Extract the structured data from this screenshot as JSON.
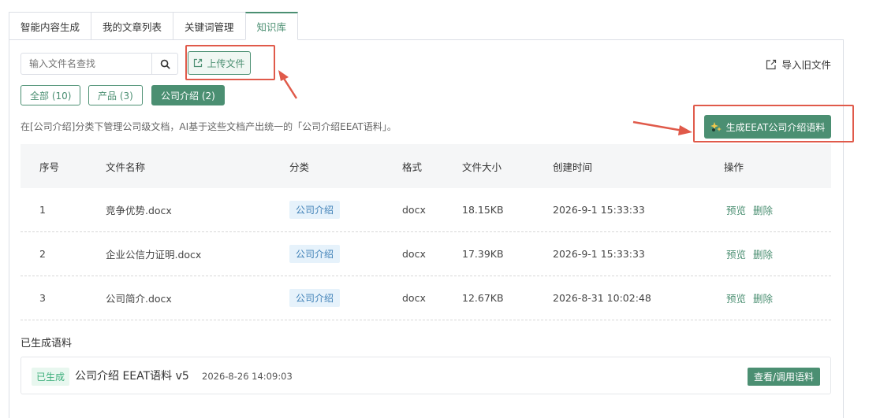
{
  "tabs": [
    {
      "label": "智能内容生成",
      "active": false
    },
    {
      "label": "我的文章列表",
      "active": false
    },
    {
      "label": "关键词管理",
      "active": false
    },
    {
      "label": "知识库",
      "active": true
    }
  ],
  "search": {
    "placeholder": "输入文件名查找"
  },
  "toolbar": {
    "upload_label": "上传文件",
    "import_label": "导入旧文件"
  },
  "filters": [
    {
      "label": "全部 (10)",
      "active": false
    },
    {
      "label": "产品 (3)",
      "active": false
    },
    {
      "label": "公司介绍 (2)",
      "active": true
    }
  ],
  "description": "在[公司介绍]分类下管理公司级文档，AI基于这些文档产出统一的「公司介绍EEAT语料」。",
  "generate_button": "生成EEAT公司介绍语料",
  "table": {
    "headers": [
      "序号",
      "文件名称",
      "分类",
      "格式",
      "文件大小",
      "创建时间",
      "操作"
    ],
    "rows": [
      {
        "index": "1",
        "name": "竞争优势.docx",
        "category": "公司介绍",
        "format": "docx",
        "size": "18.15KB",
        "created": "2026-9-1 15:33:33"
      },
      {
        "index": "2",
        "name": "企业公信力证明.docx",
        "category": "公司介绍",
        "format": "docx",
        "size": "17.39KB",
        "created": "2026-9-1 15:33:33"
      },
      {
        "index": "3",
        "name": "公司简介.docx",
        "category": "公司介绍",
        "format": "docx",
        "size": "12.67KB",
        "created": "2026-8-31 10:02:48"
      }
    ],
    "actions": {
      "preview": "预览",
      "delete": "删除"
    }
  },
  "generated": {
    "section_title": "已生成语料",
    "badge": "已生成",
    "name": "公司介绍 EEAT语料 v5",
    "time": "2026-8-26 14:09:03",
    "view_button": "查看/调用语料"
  },
  "colors": {
    "accent": "#4b8f72",
    "annotation": "#e05a4a",
    "tag_bg": "#e6f2fb"
  }
}
